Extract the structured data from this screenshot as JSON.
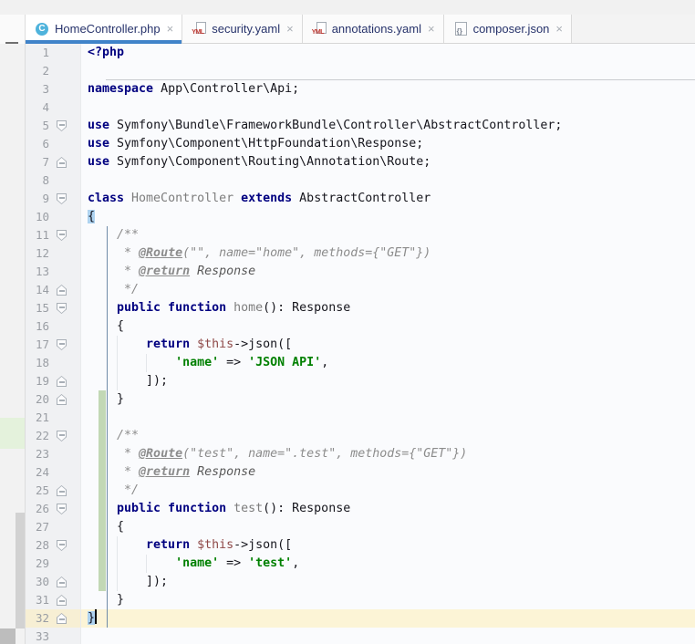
{
  "window": {
    "minimize_glyph": "—"
  },
  "tab_bar": {
    "close_glyph": "×",
    "php_class_badge": "C",
    "yaml_badge": "YML",
    "json_badge": "{}",
    "tabs": [
      {
        "label": "HomeController.php",
        "icon": "php-class",
        "active": true
      },
      {
        "label": "security.yaml",
        "icon": "yaml",
        "active": false
      },
      {
        "label": "annotations.yaml",
        "icon": "yaml",
        "active": false
      },
      {
        "label": "composer.json",
        "icon": "json",
        "active": false
      }
    ]
  },
  "colors": {
    "accent_tab_underline": "#4083C9",
    "keyword": "#000080",
    "string": "#008000",
    "variable": "#8F4A49",
    "comment": "#8C8C8C",
    "declaration_name": "#7D7D7D",
    "default_text": "#16161D",
    "line_number": "#9A9EA4",
    "vcs_added_strip": "#C2D8B5",
    "current_line_bg": "#FCF4D6",
    "brace_match_bg": "#AED3F0"
  },
  "editor": {
    "language": "php",
    "separator_after_line": 2,
    "changed_lines": {
      "from": 20,
      "to": 30
    },
    "scope_highlight": {
      "from": 10,
      "to": 31
    },
    "current_line": 32,
    "lines": [
      {
        "n": 1,
        "tokens": [
          [
            "kw",
            "<?php"
          ]
        ]
      },
      {
        "n": 2,
        "tokens": []
      },
      {
        "n": 3,
        "tokens": [
          [
            "kw",
            "namespace"
          ],
          [
            "pl",
            " App\\Controller\\Api;"
          ]
        ]
      },
      {
        "n": 4,
        "tokens": []
      },
      {
        "n": 5,
        "marker": "down",
        "tokens": [
          [
            "kw",
            "use"
          ],
          [
            "pl",
            " Symfony\\Bundle\\FrameworkBundle\\Controller\\AbstractController;"
          ]
        ]
      },
      {
        "n": 6,
        "tokens": [
          [
            "kw",
            "use"
          ],
          [
            "pl",
            " Symfony\\Component\\HttpFoundation\\Response;"
          ]
        ]
      },
      {
        "n": 7,
        "marker": "up",
        "tokens": [
          [
            "kw",
            "use"
          ],
          [
            "pl",
            " Symfony\\Component\\Routing\\Annotation\\Route;"
          ]
        ]
      },
      {
        "n": 8,
        "tokens": []
      },
      {
        "n": 9,
        "marker": "down",
        "tokens": [
          [
            "kw",
            "class"
          ],
          [
            "decl",
            " HomeController "
          ],
          [
            "kw",
            "extends"
          ],
          [
            "pl",
            " AbstractController"
          ]
        ]
      },
      {
        "n": 10,
        "tokens": [
          [
            "brhl",
            "{"
          ]
        ]
      },
      {
        "n": 11,
        "marker": "down",
        "tokens": [
          [
            "cmt",
            "    /**"
          ]
        ]
      },
      {
        "n": 12,
        "tokens": [
          [
            "cmt",
            "     * "
          ],
          [
            "tag",
            "@Route"
          ],
          [
            "cmt",
            "(\"\", name=\"home\", methods={\"GET\"})"
          ]
        ]
      },
      {
        "n": 13,
        "tokens": [
          [
            "cmt",
            "     * "
          ],
          [
            "tag",
            "@return"
          ],
          [
            "cref",
            " Response"
          ]
        ]
      },
      {
        "n": 14,
        "marker": "up",
        "tokens": [
          [
            "cmt",
            "     */"
          ]
        ]
      },
      {
        "n": 15,
        "marker": "down",
        "tokens": [
          [
            "kw",
            "    public function"
          ],
          [
            "decl",
            " home"
          ],
          [
            "pl",
            "(): Response"
          ]
        ]
      },
      {
        "n": 16,
        "tokens": [
          [
            "pl",
            "    {"
          ]
        ]
      },
      {
        "n": 17,
        "marker": "down",
        "guides": [
          4
        ],
        "tokens": [
          [
            "kw",
            "        return"
          ],
          [
            "var",
            " $this"
          ],
          [
            "pl",
            "->json(["
          ]
        ]
      },
      {
        "n": 18,
        "guides": [
          4,
          8
        ],
        "tokens": [
          [
            "str",
            "            'name'"
          ],
          [
            "pl",
            " => "
          ],
          [
            "str",
            "'JSON API'"
          ],
          [
            "pl",
            ","
          ]
        ]
      },
      {
        "n": 19,
        "marker": "up",
        "guides": [
          4
        ],
        "tokens": [
          [
            "pl",
            "        ]);"
          ]
        ]
      },
      {
        "n": 20,
        "marker": "up",
        "tokens": [
          [
            "pl",
            "    }"
          ]
        ]
      },
      {
        "n": 21,
        "tokens": []
      },
      {
        "n": 22,
        "marker": "down",
        "tokens": [
          [
            "cmt",
            "    /**"
          ]
        ]
      },
      {
        "n": 23,
        "tokens": [
          [
            "cmt",
            "     * "
          ],
          [
            "tag",
            "@Route"
          ],
          [
            "cmt",
            "(\"test\", name=\".test\", methods={\"GET\"})"
          ]
        ]
      },
      {
        "n": 24,
        "tokens": [
          [
            "cmt",
            "     * "
          ],
          [
            "tag",
            "@return"
          ],
          [
            "cref",
            " Response"
          ]
        ]
      },
      {
        "n": 25,
        "marker": "up",
        "tokens": [
          [
            "cmt",
            "     */"
          ]
        ]
      },
      {
        "n": 26,
        "marker": "down",
        "tokens": [
          [
            "kw",
            "    public function"
          ],
          [
            "decl",
            " test"
          ],
          [
            "pl",
            "(): Response"
          ]
        ]
      },
      {
        "n": 27,
        "tokens": [
          [
            "pl",
            "    {"
          ]
        ]
      },
      {
        "n": 28,
        "marker": "down",
        "guides": [
          4
        ],
        "tokens": [
          [
            "kw",
            "        return"
          ],
          [
            "var",
            " $this"
          ],
          [
            "pl",
            "->json(["
          ]
        ]
      },
      {
        "n": 29,
        "guides": [
          4,
          8
        ],
        "tokens": [
          [
            "str",
            "            'name'"
          ],
          [
            "pl",
            " => "
          ],
          [
            "str",
            "'test'"
          ],
          [
            "pl",
            ","
          ]
        ]
      },
      {
        "n": 30,
        "marker": "up",
        "guides": [
          4
        ],
        "tokens": [
          [
            "pl",
            "        ]);"
          ]
        ]
      },
      {
        "n": 31,
        "marker": "up",
        "tokens": [
          [
            "pl",
            "    }"
          ]
        ]
      },
      {
        "n": 32,
        "marker": "up",
        "cur": true,
        "caret": true,
        "tokens": [
          [
            "brhl",
            "}"
          ]
        ]
      },
      {
        "n": 33,
        "tokens": []
      }
    ]
  }
}
